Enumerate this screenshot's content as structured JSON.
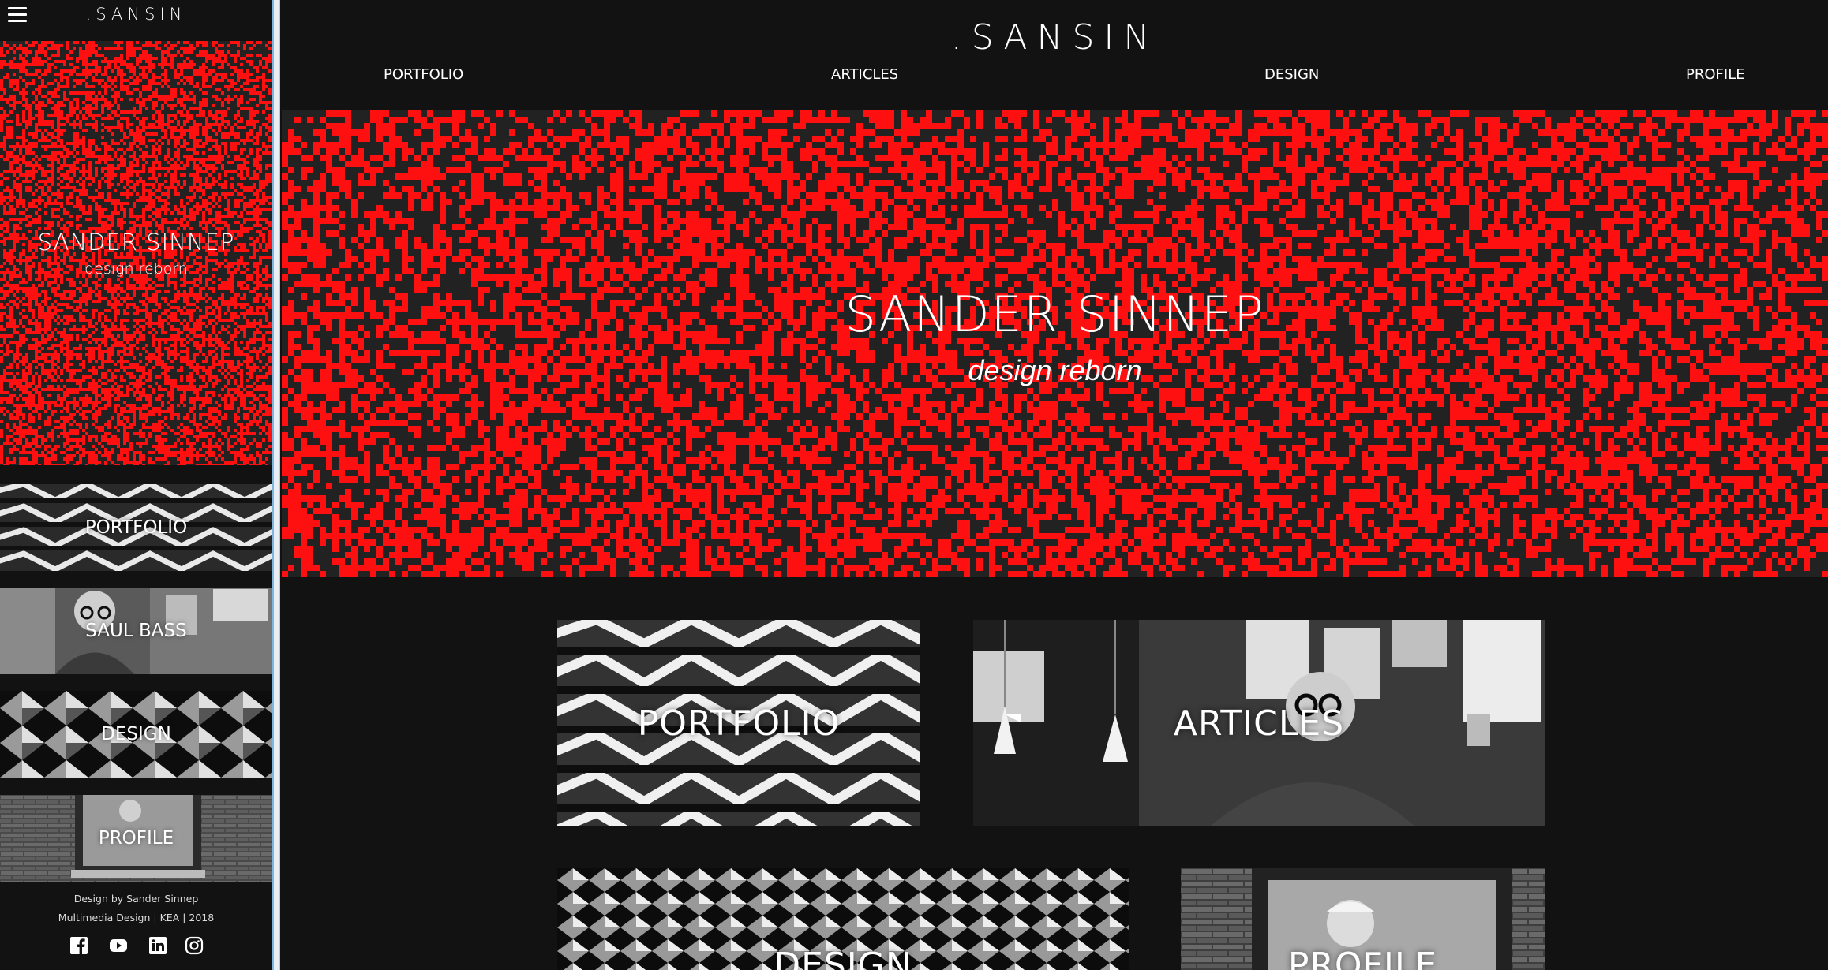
{
  "sidebar": {
    "logo": ".SANSIN",
    "hero_title": "SANDER SINNEP",
    "hero_subtitle": "design reborn",
    "tiles": [
      {
        "label": "PORTFOLIO"
      },
      {
        "label": "SAUL BASS"
      },
      {
        "label": "DESIGN"
      },
      {
        "label": "PROFILE"
      }
    ],
    "footer_line1": "Design by Sander Sinnep",
    "footer_line2": "Multimedia Design | KEA | 2018",
    "social": [
      "facebook-icon",
      "youtube-icon",
      "linkedin-icon",
      "instagram-icon"
    ]
  },
  "header": {
    "logo": ".SANSIN",
    "nav": [
      "PORTFOLIO",
      "ARTICLES",
      "DESIGN",
      "PROFILE"
    ]
  },
  "hero": {
    "title": "SANDER SINNEP",
    "subtitle": "design reborn"
  },
  "cards": [
    {
      "label": "PORTFOLIO"
    },
    {
      "label": "ARTICLES"
    },
    {
      "label": "DESIGN"
    },
    {
      "label": "PROFILE"
    }
  ],
  "colors": {
    "background": "#121212",
    "accent_red": "#ff1010",
    "pattern_dark": "#222222",
    "text": "#ffffff"
  }
}
